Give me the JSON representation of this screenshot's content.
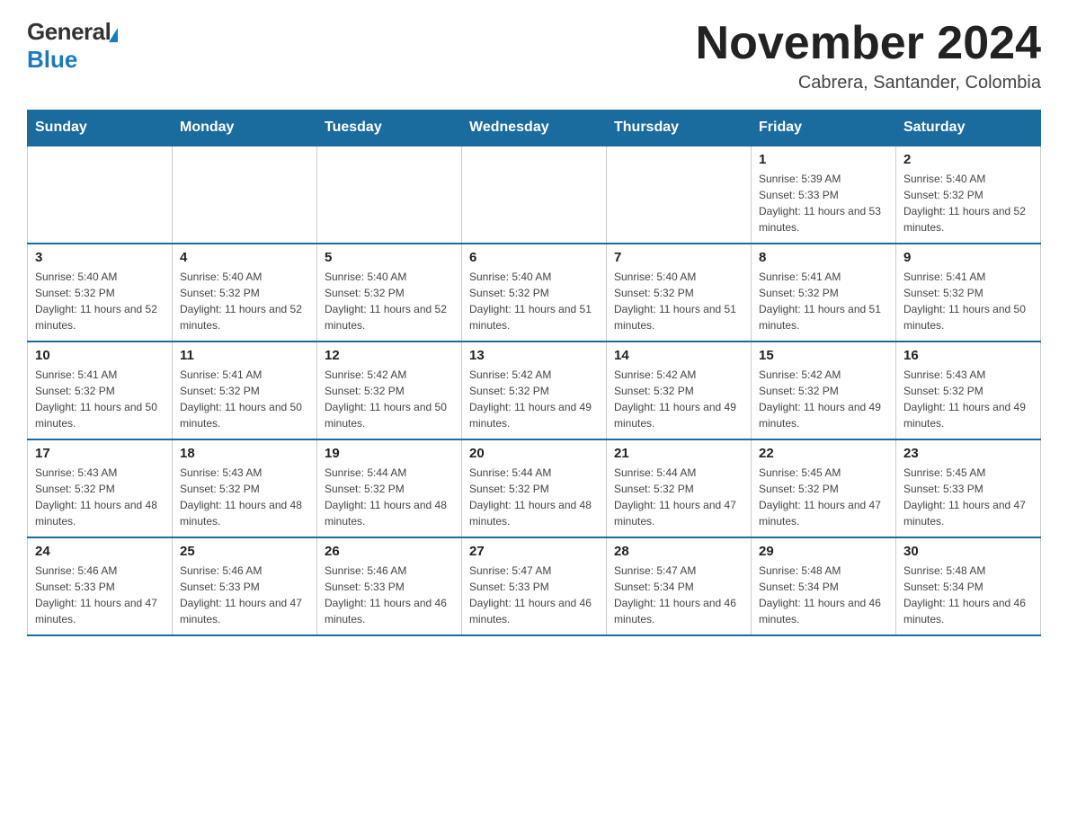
{
  "header": {
    "logo_general": "General",
    "logo_blue": "Blue",
    "month_title": "November 2024",
    "location": "Cabrera, Santander, Colombia"
  },
  "days_of_week": [
    "Sunday",
    "Monday",
    "Tuesday",
    "Wednesday",
    "Thursday",
    "Friday",
    "Saturday"
  ],
  "weeks": [
    [
      {
        "day": "",
        "info": ""
      },
      {
        "day": "",
        "info": ""
      },
      {
        "day": "",
        "info": ""
      },
      {
        "day": "",
        "info": ""
      },
      {
        "day": "",
        "info": ""
      },
      {
        "day": "1",
        "info": "Sunrise: 5:39 AM\nSunset: 5:33 PM\nDaylight: 11 hours and 53 minutes."
      },
      {
        "day": "2",
        "info": "Sunrise: 5:40 AM\nSunset: 5:32 PM\nDaylight: 11 hours and 52 minutes."
      }
    ],
    [
      {
        "day": "3",
        "info": "Sunrise: 5:40 AM\nSunset: 5:32 PM\nDaylight: 11 hours and 52 minutes."
      },
      {
        "day": "4",
        "info": "Sunrise: 5:40 AM\nSunset: 5:32 PM\nDaylight: 11 hours and 52 minutes."
      },
      {
        "day": "5",
        "info": "Sunrise: 5:40 AM\nSunset: 5:32 PM\nDaylight: 11 hours and 52 minutes."
      },
      {
        "day": "6",
        "info": "Sunrise: 5:40 AM\nSunset: 5:32 PM\nDaylight: 11 hours and 51 minutes."
      },
      {
        "day": "7",
        "info": "Sunrise: 5:40 AM\nSunset: 5:32 PM\nDaylight: 11 hours and 51 minutes."
      },
      {
        "day": "8",
        "info": "Sunrise: 5:41 AM\nSunset: 5:32 PM\nDaylight: 11 hours and 51 minutes."
      },
      {
        "day": "9",
        "info": "Sunrise: 5:41 AM\nSunset: 5:32 PM\nDaylight: 11 hours and 50 minutes."
      }
    ],
    [
      {
        "day": "10",
        "info": "Sunrise: 5:41 AM\nSunset: 5:32 PM\nDaylight: 11 hours and 50 minutes."
      },
      {
        "day": "11",
        "info": "Sunrise: 5:41 AM\nSunset: 5:32 PM\nDaylight: 11 hours and 50 minutes."
      },
      {
        "day": "12",
        "info": "Sunrise: 5:42 AM\nSunset: 5:32 PM\nDaylight: 11 hours and 50 minutes."
      },
      {
        "day": "13",
        "info": "Sunrise: 5:42 AM\nSunset: 5:32 PM\nDaylight: 11 hours and 49 minutes."
      },
      {
        "day": "14",
        "info": "Sunrise: 5:42 AM\nSunset: 5:32 PM\nDaylight: 11 hours and 49 minutes."
      },
      {
        "day": "15",
        "info": "Sunrise: 5:42 AM\nSunset: 5:32 PM\nDaylight: 11 hours and 49 minutes."
      },
      {
        "day": "16",
        "info": "Sunrise: 5:43 AM\nSunset: 5:32 PM\nDaylight: 11 hours and 49 minutes."
      }
    ],
    [
      {
        "day": "17",
        "info": "Sunrise: 5:43 AM\nSunset: 5:32 PM\nDaylight: 11 hours and 48 minutes."
      },
      {
        "day": "18",
        "info": "Sunrise: 5:43 AM\nSunset: 5:32 PM\nDaylight: 11 hours and 48 minutes."
      },
      {
        "day": "19",
        "info": "Sunrise: 5:44 AM\nSunset: 5:32 PM\nDaylight: 11 hours and 48 minutes."
      },
      {
        "day": "20",
        "info": "Sunrise: 5:44 AM\nSunset: 5:32 PM\nDaylight: 11 hours and 48 minutes."
      },
      {
        "day": "21",
        "info": "Sunrise: 5:44 AM\nSunset: 5:32 PM\nDaylight: 11 hours and 47 minutes."
      },
      {
        "day": "22",
        "info": "Sunrise: 5:45 AM\nSunset: 5:32 PM\nDaylight: 11 hours and 47 minutes."
      },
      {
        "day": "23",
        "info": "Sunrise: 5:45 AM\nSunset: 5:33 PM\nDaylight: 11 hours and 47 minutes."
      }
    ],
    [
      {
        "day": "24",
        "info": "Sunrise: 5:46 AM\nSunset: 5:33 PM\nDaylight: 11 hours and 47 minutes."
      },
      {
        "day": "25",
        "info": "Sunrise: 5:46 AM\nSunset: 5:33 PM\nDaylight: 11 hours and 47 minutes."
      },
      {
        "day": "26",
        "info": "Sunrise: 5:46 AM\nSunset: 5:33 PM\nDaylight: 11 hours and 46 minutes."
      },
      {
        "day": "27",
        "info": "Sunrise: 5:47 AM\nSunset: 5:33 PM\nDaylight: 11 hours and 46 minutes."
      },
      {
        "day": "28",
        "info": "Sunrise: 5:47 AM\nSunset: 5:34 PM\nDaylight: 11 hours and 46 minutes."
      },
      {
        "day": "29",
        "info": "Sunrise: 5:48 AM\nSunset: 5:34 PM\nDaylight: 11 hours and 46 minutes."
      },
      {
        "day": "30",
        "info": "Sunrise: 5:48 AM\nSunset: 5:34 PM\nDaylight: 11 hours and 46 minutes."
      }
    ]
  ]
}
